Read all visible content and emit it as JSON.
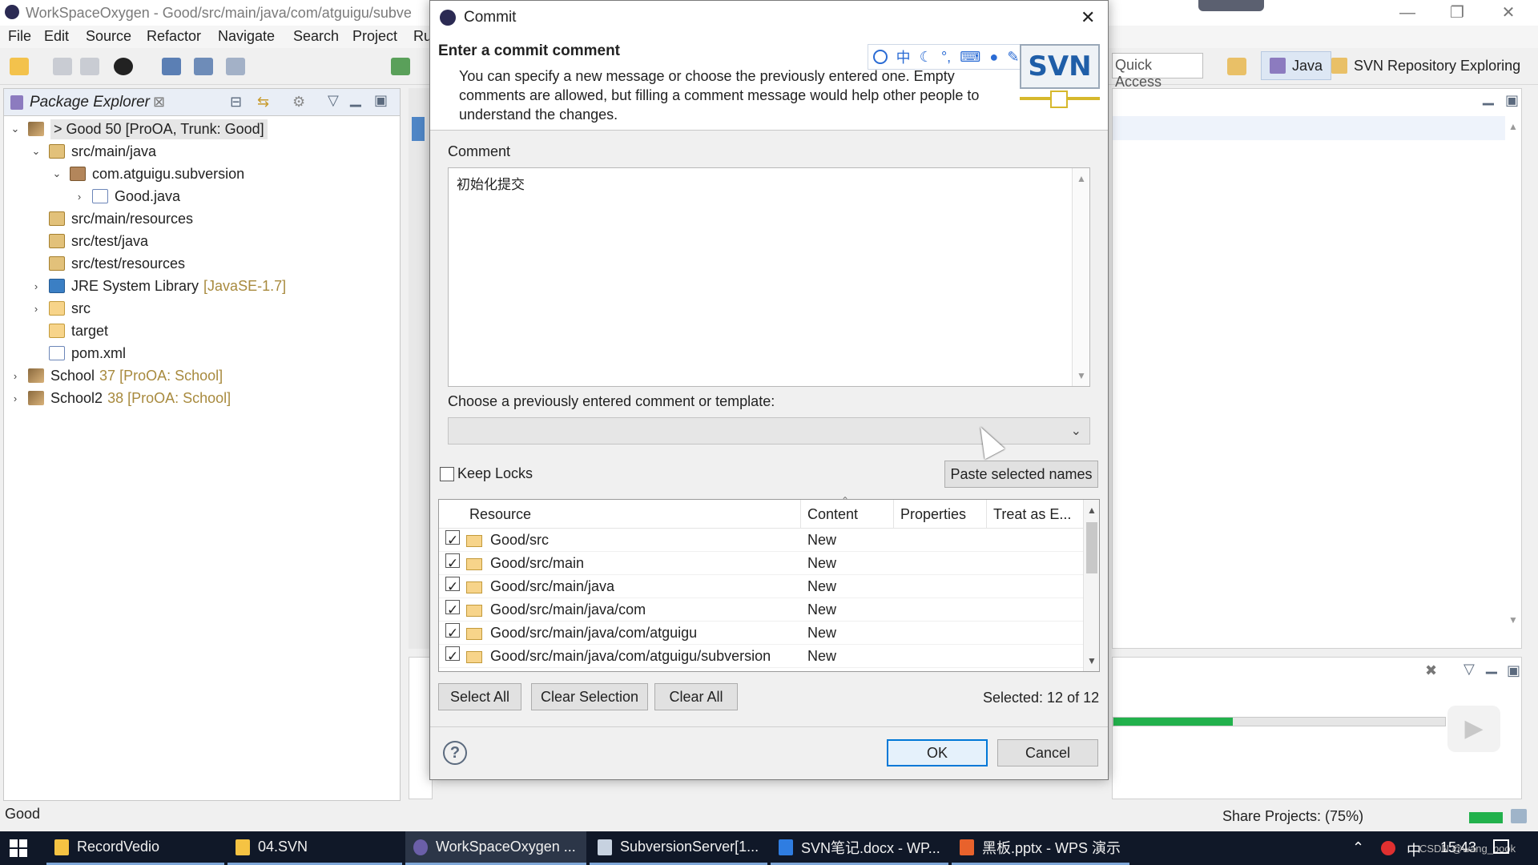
{
  "eclipse": {
    "title": "WorkSpaceOxygen - Good/src/main/java/com/atguigu/subve",
    "menu": [
      "File",
      "Edit",
      "Source",
      "Refactor",
      "Navigate",
      "Search",
      "Project",
      "Ru"
    ],
    "quick_access": "Quick Access",
    "perspectives": [
      "Java",
      "SVN Repository Exploring"
    ],
    "status_left": "Good",
    "status_right": "Share Projects: (75%)"
  },
  "package_explorer": {
    "title": "Package Explorer",
    "tree": [
      {
        "label": "> Good 50 [ProOA, Trunk: Good]",
        "deco": "",
        "icon": "project",
        "twisty": "v"
      },
      {
        "label": "src/main/java",
        "deco": "",
        "icon": "source-folder",
        "twisty": "v"
      },
      {
        "label": "com.atguigu.subversion",
        "deco": "",
        "icon": "package",
        "twisty": "v"
      },
      {
        "label": "Good.java",
        "deco": "",
        "icon": "java-file",
        "twisty": ">"
      },
      {
        "label": "src/main/resources",
        "deco": "",
        "icon": "source-folder",
        "twisty": ""
      },
      {
        "label": "src/test/java",
        "deco": "",
        "icon": "source-folder",
        "twisty": ""
      },
      {
        "label": "src/test/resources",
        "deco": "",
        "icon": "source-folder",
        "twisty": ""
      },
      {
        "label": "JRE System Library",
        "deco": "[JavaSE-1.7]",
        "icon": "library",
        "twisty": ">"
      },
      {
        "label": "src",
        "deco": "",
        "icon": "folder",
        "twisty": ">"
      },
      {
        "label": "target",
        "deco": "",
        "icon": "folder",
        "twisty": ""
      },
      {
        "label": "pom.xml",
        "deco": "",
        "icon": "xml-file",
        "twisty": ""
      },
      {
        "label": "School",
        "deco": "37 [ProOA: School]",
        "icon": "project",
        "twisty": ">"
      },
      {
        "label": "School2",
        "deco": "38 [ProOA: School]",
        "icon": "project",
        "twisty": ">"
      }
    ]
  },
  "dialog": {
    "title": "Commit",
    "header_title": "Enter a commit comment",
    "header_desc": "You can specify a new message or choose the previously entered one. Empty comments are allowed, but filling a comment message would help other people to understand the changes.",
    "logo_text": "SVN",
    "comment_label": "Comment",
    "comment_value": "初始化提交",
    "template_label": "Choose a previously entered comment or template:",
    "keep_locks": "Keep Locks",
    "paste_names": "Paste selected names",
    "columns": [
      "Resource",
      "Content",
      "Properties",
      "Treat as E..."
    ],
    "rows": [
      {
        "resource": "Good/src",
        "content": "New"
      },
      {
        "resource": "Good/src/main",
        "content": "New"
      },
      {
        "resource": "Good/src/main/java",
        "content": "New"
      },
      {
        "resource": "Good/src/main/java/com",
        "content": "New"
      },
      {
        "resource": "Good/src/main/java/com/atguigu",
        "content": "New"
      },
      {
        "resource": "Good/src/main/java/com/atguigu/subversion",
        "content": "New"
      }
    ],
    "select_all": "Select All",
    "clear_selection": "Clear Selection",
    "clear_all": "Clear All",
    "selected_count": "Selected: 12 of 12",
    "ok": "OK",
    "cancel": "Cancel"
  },
  "ime_bar": {
    "items": [
      "中",
      "°,",
      "⌨"
    ]
  },
  "taskbar": {
    "items": [
      "RecordVedio",
      "04.SVN",
      "WorkSpaceOxygen ...",
      "SubversionServer[1...",
      "SVN笔记.docx - WP...",
      "黑板.pptx - WPS 演示"
    ],
    "ime": "中",
    "time": "15:43",
    "watermark": "CSDN @wang_book"
  },
  "colors": {
    "accent": "#0078d7",
    "progress": "#22b14c",
    "taskbar": "#101828",
    "decoration": "#a88a3e"
  }
}
